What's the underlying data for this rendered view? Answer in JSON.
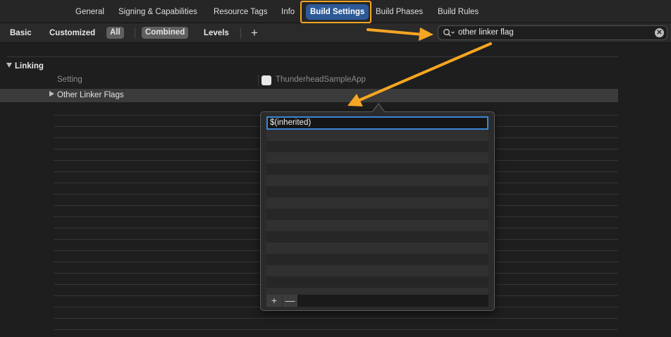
{
  "tabs": [
    {
      "label": "General"
    },
    {
      "label": "Signing & Capabilities"
    },
    {
      "label": "Resource Tags"
    },
    {
      "label": "Info"
    },
    {
      "label": "Build Settings"
    },
    {
      "label": "Build Phases"
    },
    {
      "label": "Build Rules"
    }
  ],
  "filters": {
    "basic": "Basic",
    "customized": "Customized",
    "all": "All",
    "combined": "Combined",
    "levels": "Levels",
    "add": "+"
  },
  "search": {
    "value": "other linker flag",
    "clear": "✕"
  },
  "section": {
    "title": "Linking",
    "column_setting": "Setting",
    "target": "ThunderheadSampleApp",
    "row_name": "Other Linker Flags"
  },
  "popover": {
    "value": "$(inherited)",
    "add": "+",
    "remove": "—"
  },
  "colors": {
    "accent": "#2d5a97",
    "annotation": "#f5a623",
    "focus": "#3a86d6"
  }
}
